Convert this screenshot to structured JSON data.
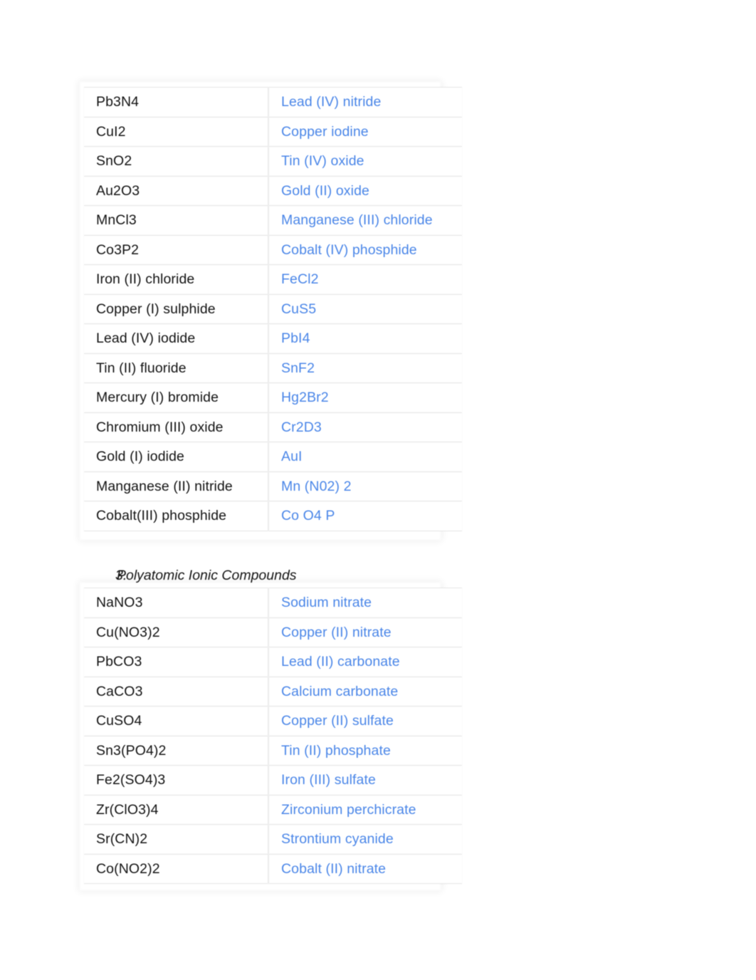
{
  "document": {
    "accent_color": "#4a86e8",
    "text_color": "#131313",
    "background_color": "#ffffff"
  },
  "sections": [
    {
      "id": "binary-ionic",
      "heading_number": "",
      "heading_title": "",
      "rows": [
        {
          "formula": "Pb3N4",
          "name": "Lead (IV) nitride"
        },
        {
          "formula": "CuI2",
          "name": "Copper iodine"
        },
        {
          "formula": "SnO2",
          "name": "Tin (IV) oxide"
        },
        {
          "formula": "Au2O3",
          "name": "Gold (II) oxide"
        },
        {
          "formula": "MnCl3",
          "name": "Manganese (III) chloride"
        },
        {
          "formula": "Co3P2",
          "name": "Cobalt (IV) phosphide"
        },
        {
          "formula": "Iron (II) chloride",
          "name": "FeCl2"
        },
        {
          "formula": "Copper (I) sulphide",
          "name": "CuS5"
        },
        {
          "formula": "Lead (IV) iodide",
          "name": "PbI4"
        },
        {
          "formula": "Tin (II) fluoride",
          "name": "SnF2"
        },
        {
          "formula": "Mercury (I) bromide",
          "name": "Hg2Br2"
        },
        {
          "formula": "Chromium (III) oxide",
          "name": "Cr2D3"
        },
        {
          "formula": "Gold (I) iodide",
          "name": "AuI"
        },
        {
          "formula": "Manganese (II) nitride",
          "name": "Mn (N02) 2"
        },
        {
          "formula": "Cobalt(III) phosphide",
          "name": "Co O4 P"
        }
      ]
    },
    {
      "id": "polyatomic",
      "heading_number": "3.",
      "heading_title": "Polyatomic Ionic Compounds",
      "rows": [
        {
          "formula": "NaNO3",
          "name": "Sodium nitrate"
        },
        {
          "formula": "Cu(NO3)2",
          "name": "Copper (II) nitrate"
        },
        {
          "formula": "PbCO3",
          "name": "Lead (II) carbonate"
        },
        {
          "formula": "CaCO3",
          "name": "Calcium carbonate"
        },
        {
          "formula": "CuSO4",
          "name": "Copper (II) sulfate"
        },
        {
          "formula": "Sn3(PO4)2",
          "name": "Tin (II) phosphate"
        },
        {
          "formula": "Fe2(SO4)3",
          "name": "Iron (III) sulfate"
        },
        {
          "formula": "Zr(ClO3)4",
          "name": "Zirconium perchicrate"
        },
        {
          "formula": "Sr(CN)2",
          "name": "Strontium cyanide"
        },
        {
          "formula": "Co(NO2)2",
          "name": "Cobalt (II) nitrate"
        }
      ]
    }
  ]
}
